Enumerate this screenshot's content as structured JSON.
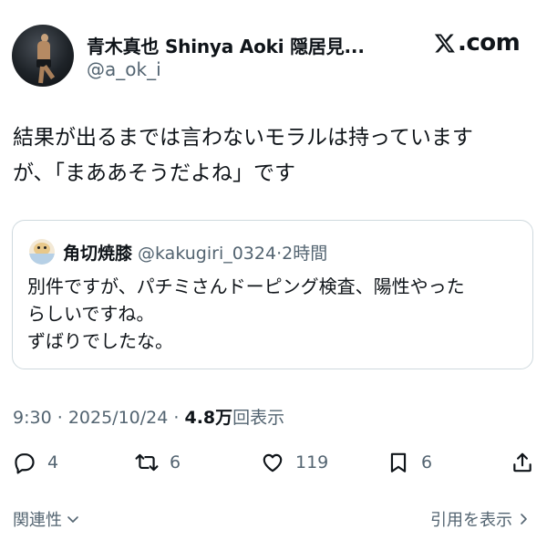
{
  "author": {
    "display_name": "青木真也 Shinya Aoki 隠居見...",
    "handle": "@a_ok_i"
  },
  "brand": {
    "site_label": ".com",
    "logo_icon": "x-logo-icon"
  },
  "tweet": {
    "lines": [
      "結果が出るまでは言わないモラルは持っています",
      "が、「まああそうだよね」です"
    ]
  },
  "quote": {
    "name": "角切焼膝",
    "meta": "@kakugiri_0324·2時間",
    "lines": [
      "別件ですが、パチミさんドーピング検査、陽性やった",
      "らしいですね。",
      "ずばりでしたな。"
    ]
  },
  "meta": {
    "time": "9:30",
    "date": "2025/10/24",
    "separator": "·",
    "views_count": "4.8万",
    "views_label": "回表示"
  },
  "actions": {
    "reply": {
      "icon": "reply-icon",
      "count": "4"
    },
    "retweet": {
      "icon": "retweet-icon",
      "count": "6"
    },
    "like": {
      "icon": "heart-icon",
      "count": "119"
    },
    "bookmark": {
      "icon": "bookmark-icon",
      "count": "6"
    },
    "share": {
      "icon": "share-icon"
    }
  },
  "footer": {
    "relevance_label": "関連性",
    "quotes_label": "引用を表示"
  },
  "colors": {
    "text": "#0f1419",
    "secondary": "#536471",
    "border": "#cfd9de"
  }
}
